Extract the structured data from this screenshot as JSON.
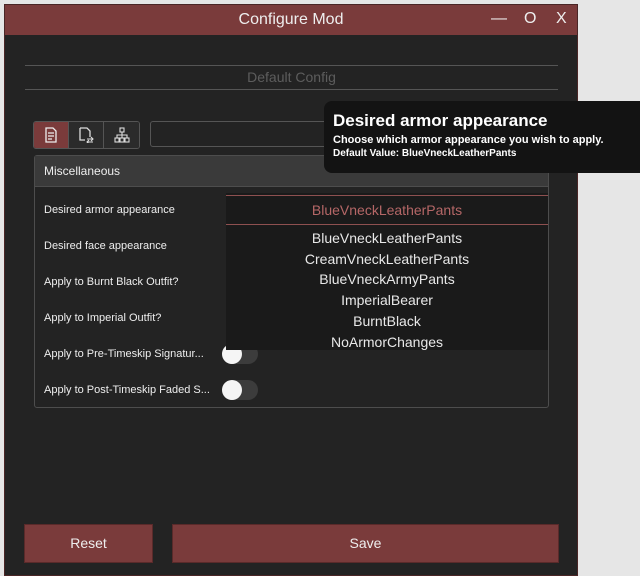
{
  "window": {
    "title": "Configure Mod",
    "controls": {
      "minimize": "—",
      "maximize": "O",
      "close": "X"
    }
  },
  "section": {
    "title": "Default Config"
  },
  "toolbar": {
    "buttons": [
      "page-icon",
      "page-arrows-icon",
      "hierarchy-icon"
    ],
    "active": 0
  },
  "search": {
    "value": ""
  },
  "panel": {
    "header": "Miscellaneous",
    "rows": [
      {
        "label": "Desired armor appearance",
        "type": "dropdown"
      },
      {
        "label": "Desired face appearance",
        "type": "dropdown"
      },
      {
        "label": "Apply to Burnt Black Outfit?",
        "type": "toggle"
      },
      {
        "label": "Apply to Imperial Outfit?",
        "type": "toggle"
      },
      {
        "label": "Apply to Pre-Timeskip Signatur...",
        "type": "toggle",
        "on": false
      },
      {
        "label": "Apply to Post-Timeskip Faded S...",
        "type": "toggle",
        "on": false
      }
    ]
  },
  "dropdown": {
    "selected": "BlueVneckLeatherPants",
    "options": [
      "BlueVneckLeatherPants",
      "CreamVneckLeatherPants",
      "BlueVneckArmyPants",
      "ImperialBearer",
      "BurntBlack",
      "NoArmorChanges"
    ]
  },
  "tooltip": {
    "title": "Desired armor appearance",
    "description": "Choose which armor appearance you wish to apply.",
    "default_value": "Default Value:  BlueVneckLeatherPants"
  },
  "buttons": {
    "reset": "Reset",
    "save": "Save"
  },
  "colors": {
    "accent": "#7a3b3b",
    "background": "#232323",
    "highlight_text": "#b56767"
  }
}
